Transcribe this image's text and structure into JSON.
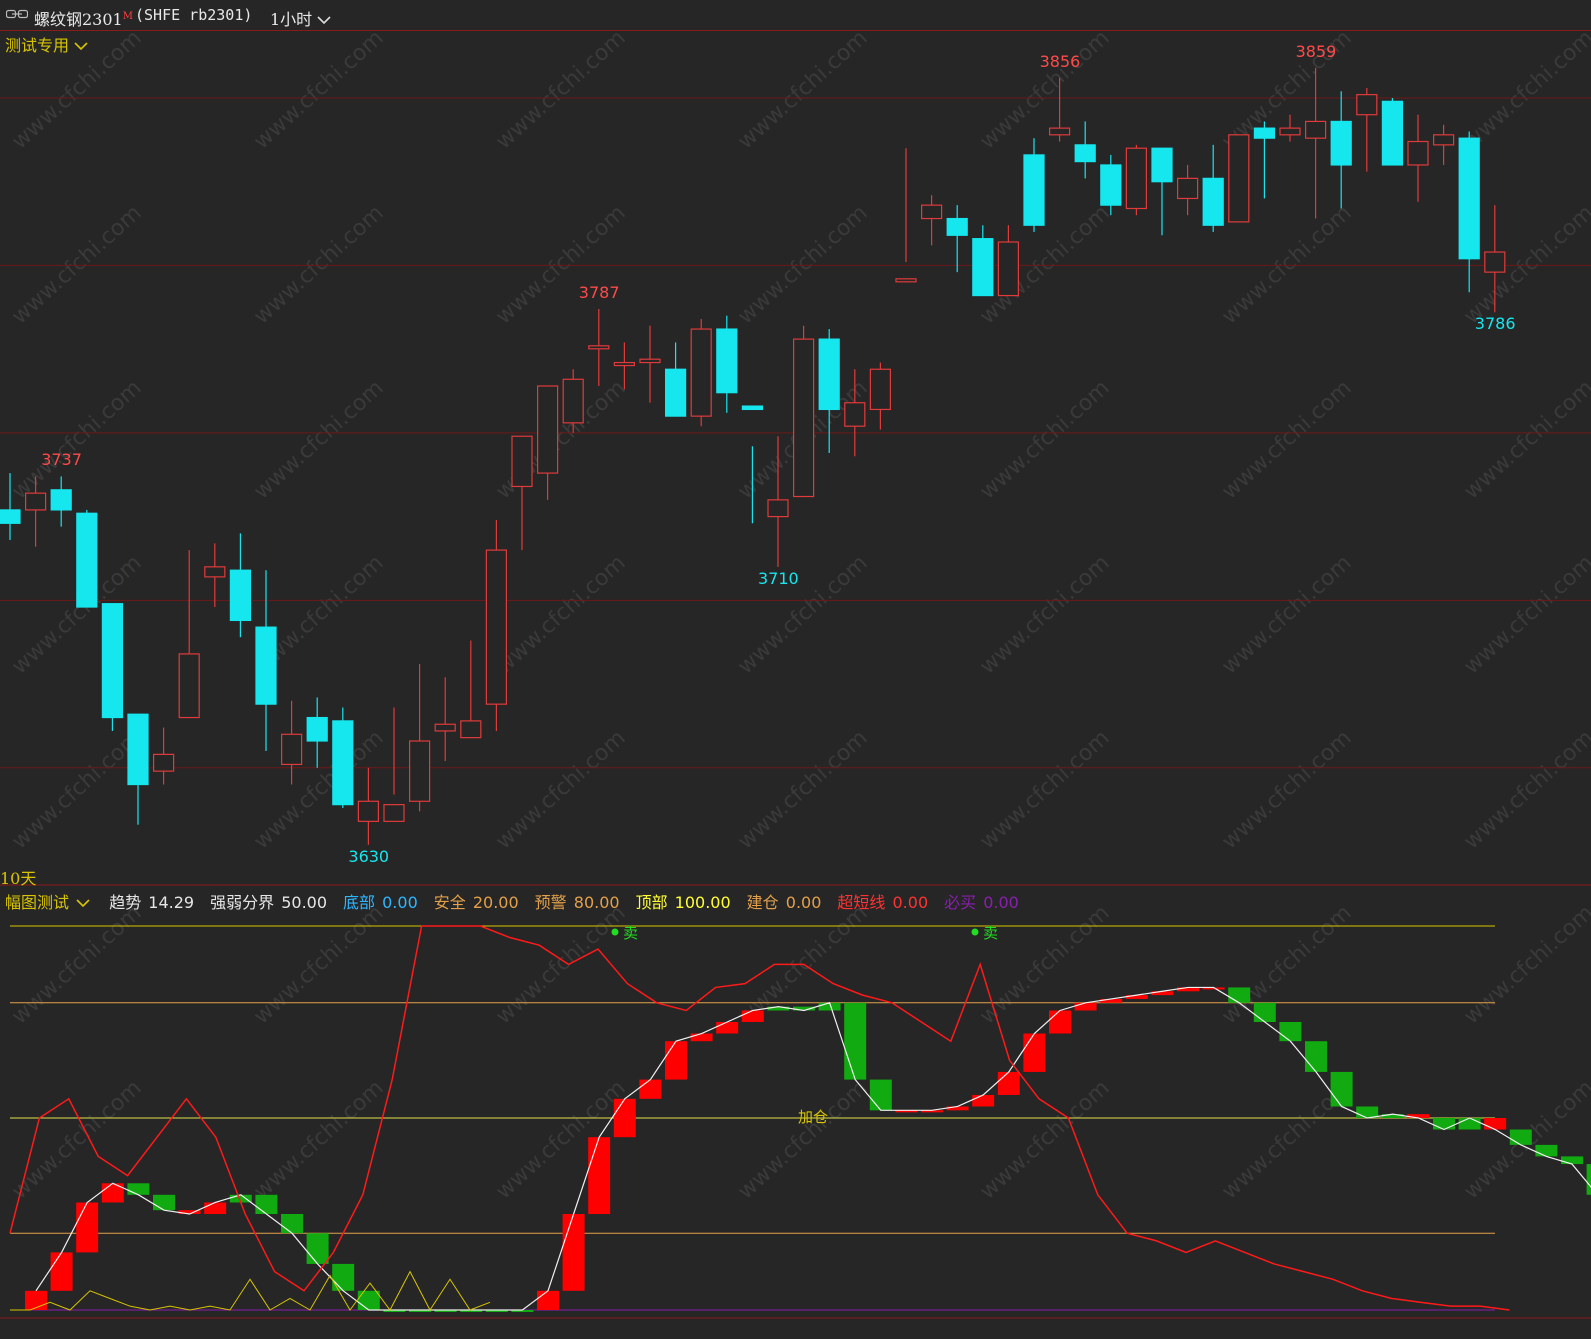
{
  "titlebar": {
    "symbol_name": "螺纹钢2301",
    "symbol_badge": "M",
    "symbol_code": "(SHFE rb2301)",
    "period": "1小时",
    "chevron_icon": "chevron-down-icon",
    "link_icon": "chain-link-icon"
  },
  "main_panel": {
    "indicator_name": "测试专用",
    "bottom_label": "10天",
    "high_low_labels": [
      {
        "text": "3737",
        "kind": "high"
      },
      {
        "text": "3630",
        "kind": "low"
      },
      {
        "text": "3787",
        "kind": "high"
      },
      {
        "text": "3710",
        "kind": "low"
      },
      {
        "text": "3856",
        "kind": "high"
      },
      {
        "text": "3859",
        "kind": "high"
      },
      {
        "text": "3786",
        "kind": "low"
      }
    ]
  },
  "sub_panel": {
    "indicator_name": "幅图测试",
    "params": [
      {
        "label": "趋势",
        "value": "14.29",
        "color": "#e6e6e6"
      },
      {
        "label": "强弱分界",
        "value": "50.00",
        "color": "#e6e6e6"
      },
      {
        "label": "底部",
        "value": "0.00",
        "color": "#2fb6ff"
      },
      {
        "label": "安全",
        "value": "20.00",
        "color": "#e3a04a"
      },
      {
        "label": "预警",
        "value": "80.00",
        "color": "#e3a04a"
      },
      {
        "label": "顶部",
        "value": "100.00",
        "color": "#ffff33"
      },
      {
        "label": "建仓",
        "value": "0.00",
        "color": "#e3a04a"
      },
      {
        "label": "超短线",
        "value": "0.00",
        "color": "#ff3333"
      },
      {
        "label": "必买",
        "value": "0.00",
        "color": "#8a1fb0"
      }
    ],
    "annotations": [
      "卖",
      "卖",
      "加仓"
    ]
  },
  "colors": {
    "background": "#262626",
    "up_candle": "#e03a3a",
    "down_candle": "#16e6ee",
    "grid_red": "#6e1818",
    "label_yellow": "#d8c400",
    "bar_red": "#ff0000",
    "bar_green": "#11aa11"
  },
  "watermark": "www.cfchi.com",
  "chart_data": [
    {
      "type": "candlestick",
      "title": "螺纹钢2301 (SHFE rb2301) 1小时",
      "ohlc": [
        [
          3727,
          3738,
          3718,
          3723
        ],
        [
          3727,
          3737,
          3716,
          3732
        ],
        [
          3733,
          3737,
          3722,
          3727
        ],
        [
          3726,
          3727,
          3702,
          3698
        ],
        [
          3699,
          3699,
          3661,
          3665
        ],
        [
          3666,
          3666,
          3633,
          3645
        ],
        [
          3649,
          3662,
          3645,
          3654
        ],
        [
          3665,
          3715,
          3675,
          3684
        ],
        [
          3707,
          3717,
          3698,
          3710
        ],
        [
          3709,
          3720,
          3689,
          3694
        ],
        [
          3692,
          3709,
          3655,
          3669
        ],
        [
          3651,
          3670,
          3645,
          3660
        ],
        [
          3665,
          3671,
          3650,
          3658
        ],
        [
          3664,
          3668,
          3638,
          3639
        ],
        [
          3634,
          3650,
          3627,
          3640
        ],
        [
          3634,
          3668,
          3642,
          3639
        ],
        [
          3640,
          3681,
          3637,
          3658
        ],
        [
          3661,
          3677,
          3652,
          3663
        ],
        [
          3659,
          3688,
          3661,
          3664
        ],
        [
          3669,
          3724,
          3661,
          3715
        ],
        [
          3734,
          3743,
          3715,
          3749
        ],
        [
          3738,
          3751,
          3730,
          3764
        ],
        [
          3753,
          3769,
          3750,
          3766
        ],
        [
          3776,
          3787,
          3764,
          3776
        ],
        [
          3771,
          3777,
          3763,
          3771
        ],
        [
          3771,
          3782,
          3759,
          3772
        ],
        [
          3769,
          3777,
          3755,
          3755
        ],
        [
          3755,
          3784,
          3752,
          3781
        ],
        [
          3781,
          3785,
          3756,
          3762
        ],
        [
          3758,
          3746,
          3723,
          3757
        ],
        [
          3725,
          3749,
          3710,
          3730
        ],
        [
          3731,
          3782,
          3733,
          3778
        ],
        [
          3778,
          3781,
          3744,
          3757
        ],
        [
          3752,
          3769,
          3743,
          3759
        ],
        [
          3757,
          3771,
          3751,
          3769
        ],
        [
          3796,
          3835,
          3801,
          3796
        ],
        [
          3814,
          3821,
          3806,
          3818
        ],
        [
          3814,
          3818,
          3798,
          3809
        ],
        [
          3808,
          3812,
          3791,
          3791
        ],
        [
          3791,
          3812,
          3792,
          3807
        ],
        [
          3833,
          3838,
          3810,
          3812
        ],
        [
          3839,
          3856,
          3837,
          3841
        ],
        [
          3836,
          3843,
          3826,
          3831
        ],
        [
          3830,
          3833,
          3815,
          3818
        ],
        [
          3817,
          3836,
          3815,
          3835
        ],
        [
          3835,
          3833,
          3809,
          3825
        ],
        [
          3820,
          3830,
          3815,
          3826
        ],
        [
          3826,
          3836,
          3810,
          3812
        ],
        [
          3813,
          3835,
          3822,
          3839
        ],
        [
          3841,
          3843,
          3820,
          3838
        ],
        [
          3839,
          3845,
          3837,
          3841
        ],
        [
          3838,
          3859,
          3814,
          3843
        ],
        [
          3843,
          3852,
          3817,
          3830
        ],
        [
          3845,
          3853,
          3828,
          3851
        ],
        [
          3849,
          3850,
          3833,
          3830
        ],
        [
          3830,
          3845,
          3819,
          3837
        ],
        [
          3836,
          3842,
          3830,
          3839
        ],
        [
          3838,
          3840,
          3792,
          3802
        ],
        [
          3798,
          3818,
          3786,
          3804
        ]
      ],
      "highs_marked": [
        3737,
        3787,
        3856,
        3859
      ],
      "lows_marked": [
        3630,
        3710,
        3786
      ]
    },
    {
      "type": "bar",
      "title": "幅图测试",
      "ylim": [
        0,
        100
      ],
      "reference_lines": [
        0,
        20,
        50,
        80,
        100
      ],
      "bar_values": [
        5,
        15,
        28,
        33,
        30,
        26,
        25,
        28,
        30,
        25,
        20,
        12,
        5,
        0,
        0,
        0,
        0,
        0,
        0,
        0,
        5,
        25,
        45,
        55,
        60,
        70,
        72,
        75,
        78,
        79,
        78,
        80,
        60,
        52,
        52,
        52,
        53,
        56,
        62,
        72,
        78,
        80,
        81,
        82,
        83,
        84,
        84,
        80,
        75,
        70,
        62,
        53,
        50,
        51,
        50,
        47,
        50,
        47,
        43,
        40,
        38,
        30,
        20
      ],
      "bar_colors": [
        "r",
        "r",
        "r",
        "r",
        "g",
        "g",
        "r",
        "r",
        "g",
        "g",
        "g",
        "g",
        "g",
        "g",
        "g",
        "g",
        "g",
        "g",
        "g",
        "g",
        "r",
        "r",
        "r",
        "r",
        "r",
        "r",
        "r",
        "r",
        "r",
        "g",
        "g",
        "g",
        "g",
        "g",
        "r",
        "r",
        "r",
        "r",
        "r",
        "r",
        "r",
        "r",
        "r",
        "r",
        "r",
        "r",
        "r",
        "g",
        "g",
        "g",
        "g",
        "g",
        "g",
        "g",
        "r",
        "g",
        "g",
        "r",
        "g",
        "g",
        "g",
        "g",
        "g"
      ],
      "red_line": [
        20,
        50,
        55,
        40,
        35,
        45,
        55,
        45,
        25,
        10,
        5,
        15,
        30,
        60,
        100,
        100,
        100,
        97,
        95,
        90,
        94,
        85,
        80,
        78,
        84,
        85,
        90,
        90,
        85,
        82,
        80,
        75,
        70,
        90,
        65,
        55,
        50,
        30,
        20,
        18,
        15,
        18,
        15,
        12,
        10,
        8,
        5,
        3,
        2,
        1,
        1,
        0
      ],
      "yellow_values": [
        0,
        0,
        2,
        0,
        5,
        3,
        1,
        0,
        1,
        0,
        1,
        0,
        8,
        0,
        3,
        0,
        9,
        0,
        7,
        0,
        10,
        0,
        8,
        0,
        2
      ]
    }
  ]
}
